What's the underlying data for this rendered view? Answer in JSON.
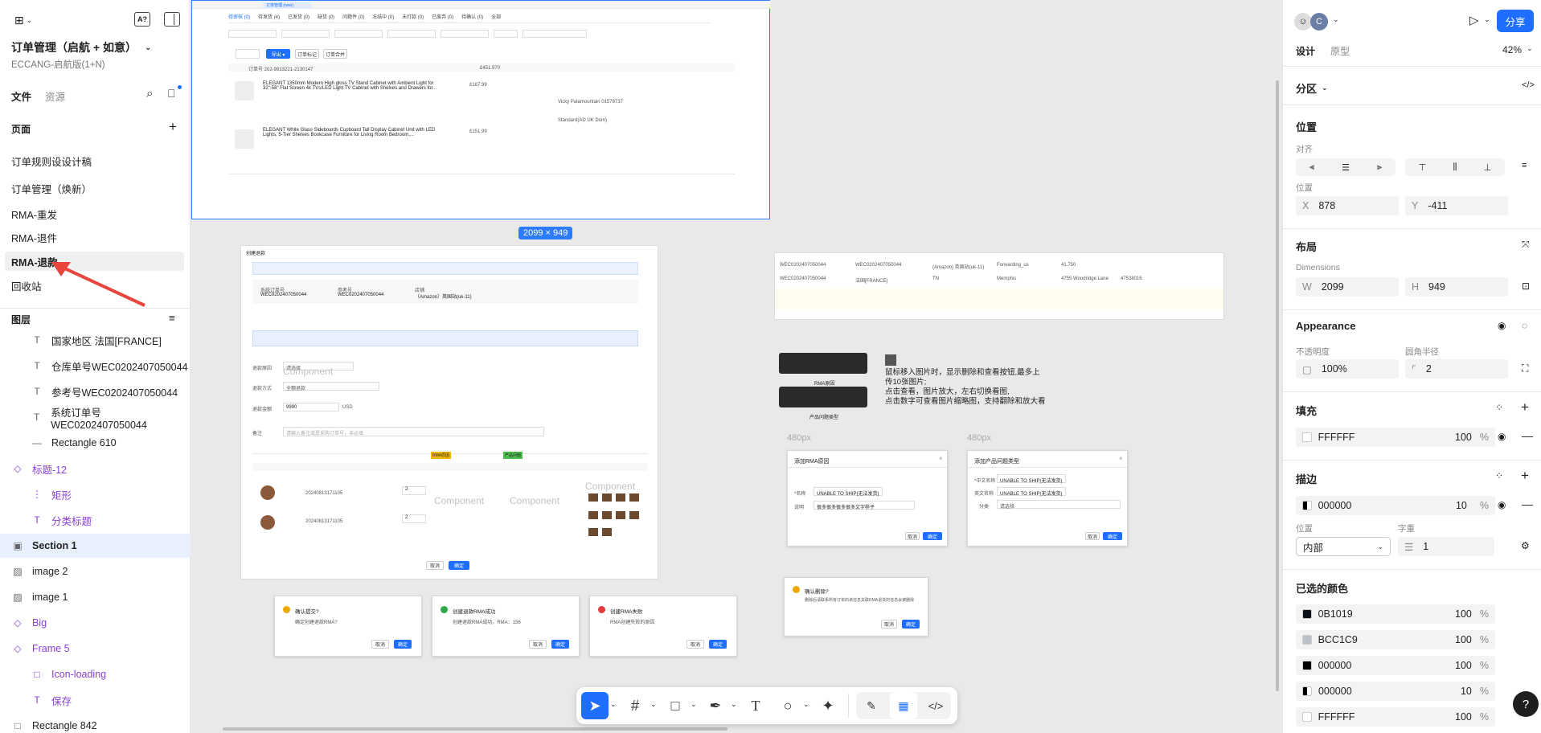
{
  "left": {
    "project_title": "订单管理（启航 + 如意）",
    "project_sub": "ECCANG-启航版(1+N)",
    "tab_files": "文件",
    "tab_assets": "资源",
    "pages_title": "页面",
    "pages": [
      "订单规则设设计稿",
      "订单管理（焕新）",
      "RMA-重发",
      "RMA-退件",
      "RMA-退款",
      "回收站"
    ],
    "layers_title": "图层",
    "layers": [
      {
        "label": "国家地区 法国[FRANCE]",
        "icon": "text-icon",
        "glyph": "T",
        "indent": 2,
        "color": "#222"
      },
      {
        "label": "仓库单号WEC0202407050044",
        "icon": "text-icon",
        "glyph": "T",
        "indent": 2,
        "color": "#222"
      },
      {
        "label": "参考号WEC0202407050044",
        "icon": "text-icon",
        "glyph": "T",
        "indent": 2,
        "color": "#222"
      },
      {
        "label": "系统订单号WEC0202407050044",
        "icon": "text-icon",
        "glyph": "T",
        "indent": 2,
        "color": "#222"
      },
      {
        "label": "Rectangle 610",
        "icon": "line-icon",
        "glyph": "—",
        "indent": 2,
        "color": "#222"
      },
      {
        "label": "标题-12",
        "icon": "component-icon",
        "glyph": "◇",
        "indent": 0,
        "color": "#8a3fd6"
      },
      {
        "label": "矩形",
        "icon": "rect-icon",
        "glyph": "⋮",
        "indent": 2,
        "color": "#8a3fd6"
      },
      {
        "label": "分类标题",
        "icon": "text-icon",
        "glyph": "T",
        "indent": 2,
        "color": "#8a3fd6"
      },
      {
        "label": "Section 1",
        "icon": "section-icon",
        "glyph": "▣",
        "indent": 0,
        "color": "#222"
      },
      {
        "label": "image 2",
        "icon": "image-icon",
        "glyph": "▨",
        "indent": 0,
        "color": "#222"
      },
      {
        "label": "image 1",
        "icon": "image-icon",
        "glyph": "▨",
        "indent": 0,
        "color": "#222"
      },
      {
        "label": "Big",
        "icon": "component-icon",
        "glyph": "◇",
        "indent": 0,
        "color": "#8a3fd6"
      },
      {
        "label": "Frame 5",
        "icon": "component-icon",
        "glyph": "◇",
        "indent": 0,
        "color": "#8a3fd6"
      },
      {
        "label": "Icon-loading",
        "icon": "frame-icon",
        "glyph": "□",
        "indent": 2,
        "color": "#8a3fd6"
      },
      {
        "label": "保存",
        "icon": "text-icon",
        "glyph": "T",
        "indent": 2,
        "color": "#8a3fd6"
      },
      {
        "label": "Rectangle 842",
        "icon": "frame-icon",
        "glyph": "□",
        "indent": 0,
        "color": "#222"
      }
    ]
  },
  "canvas": {
    "size_badge": "2099 × 949",
    "order_tabs": [
      "待审核 (0)",
      "待发货 (4)",
      "已发货 (0)",
      "缺货 (0)",
      "问题件 (0)",
      "冻结中 (0)",
      "未打款 (0)",
      "已废弃 (0)",
      "待确认 (0)",
      "全部"
    ],
    "order_total": "订单号 202-9913221-2130147",
    "order_price1": "£451.970",
    "product1": "ELEGANT 1350mm Modern High gloss TV Stand Cabinet with Ambient Light for 32\"-58\" Flat Screen 4k TVs/LED Light TV Cabinet with Shelves and Drawers for...",
    "product1_price": "£167.99",
    "product2": "ELEGANT White Glass Sideboards Cupboard Tall Display Cabinet Unit with LED Lights, 5-Tier Shelves Bookcase Furniture for Living Room Bedroom,...",
    "product2_price": "£151.99",
    "buyer": "Vicky Palamountain 01578737",
    "ship_service": "Standard(AD UK Dom)",
    "refund_title": "创建退款",
    "sys_order_label": "系统订单号",
    "sys_order": "WEC0202407050044",
    "ref_label": "参考号",
    "ref": "WEC0202407050044",
    "shop_label": "店铺",
    "shop": "（Amazon）英国站(uk-11)",
    "refund_amount_label": "退款金额",
    "refund_amount": "9990",
    "currency": "USD",
    "component": "Component",
    "refund_reason_label": "退款原因",
    "refund_reason": "请选择",
    "refund_way_label": "退款方式",
    "refund_way": "全额退款",
    "remark_label": "备注",
    "remark_ph": "请输入备注或是采购订单号，非必填",
    "rma_tag": "RMA原因",
    "product_tag": "产品问题",
    "sku1": "20240813171105",
    "sku2": "20240813171105",
    "qty": "2",
    "btn_cancel": "取消",
    "btn_confirm": "确定",
    "tip1_title": "确认提交?",
    "tip1_body": "确定创建退款RMA?",
    "tip2_title": "创建退款RMA成功",
    "tip2_body": "创建退款RMA成功，RMA：156",
    "tip3_title": "创建RMA失败",
    "tip3_body": "RMA创建失败的原因",
    "note_tag1": "RMA原因",
    "note_tag2": "产品问题类型",
    "note_text": "鼠标移入图片时，显示删除和查看按钮,最多上传10张图片;\n点击查看，图片放大，左右切换看图,\n点击数字可查看图片缩略图，支持翻除和放大看",
    "px1": "480px",
    "px2": "480px",
    "dlg1_title": "添加RMA原因",
    "dlg1_label1": "*名称",
    "dlg1_val1": "UNABLE TO SHIP(无法发货)",
    "dlg1_label2": "说明",
    "dlg1_val2": "很多很多很多很多文字样子",
    "dlg2_title": "添加产品问题类型",
    "dlg2_label1": "*中文名称",
    "dlg2_val1": "UNABLE TO SHIP(无法发货)",
    "dlg2_label2": "英文名称",
    "dlg2_val2": "UNABLE TO SHIP(无法发货)",
    "dlg2_label3": "分类",
    "dlg2_val3": "请选择",
    "confirm_title": "确认删除?",
    "confirm_body": "删除后请联系所有订单的该信息关联RMA退货的信息会被删除",
    "info_sys": "WEC0202407050044",
    "info_ref": "WEC0202407050044",
    "info_shop": "(Amazon) 英国站(uk-11)",
    "info_ship": "Forwarding_us",
    "info_amt": "41.750",
    "info_ct": "Memphis",
    "info_addr": "4755 Woodridge Lane",
    "info_zip": "47538016",
    "info_state": "TN",
    "info_country": "法国[FRANCE]"
  },
  "toolbar": {
    "tools": [
      "move-tool",
      "frame-tool",
      "shape-tool",
      "pen-tool",
      "text-tool",
      "comment-tool",
      "ai-tool"
    ]
  },
  "right": {
    "share": "分享",
    "tab_design": "设计",
    "tab_proto": "原型",
    "zoom": "42%",
    "section": "分区",
    "position_title": "位置",
    "align_label": "对齐",
    "pos_label": "位置",
    "x_label": "X",
    "x": "878",
    "y_label": "Y",
    "y": "-411",
    "layout_title": "布局",
    "dim_label": "Dimensions",
    "w_label": "W",
    "w": "2099",
    "h_label": "H",
    "h": "949",
    "appearance_title": "Appearance",
    "opacity_label": "不透明度",
    "opacity": "100%",
    "radius_label": "圆角半径",
    "radius": "2",
    "fill_title": "填充",
    "fill_hex": "FFFFFF",
    "fill_pct": "100",
    "pct": "%",
    "stroke_title": "描边",
    "stroke_hex": "000000",
    "stroke_pct": "10",
    "stroke_pos_label": "位置",
    "stroke_pos": "内部",
    "stroke_w_label": "字重",
    "stroke_w": "1",
    "colors_title": "已选的颜色",
    "colors": [
      {
        "hex": "0B1019",
        "pct": "100",
        "swatch": "#0b1019"
      },
      {
        "hex": "BCC1C9",
        "pct": "100",
        "swatch": "#bcc1c9"
      },
      {
        "hex": "000000",
        "pct": "100",
        "swatch": "#000000"
      },
      {
        "hex": "000000",
        "pct": "10",
        "swatch": "#000000"
      },
      {
        "hex": "FFFFFF",
        "pct": "100",
        "swatch": "#ffffff"
      }
    ],
    "help": "?"
  }
}
